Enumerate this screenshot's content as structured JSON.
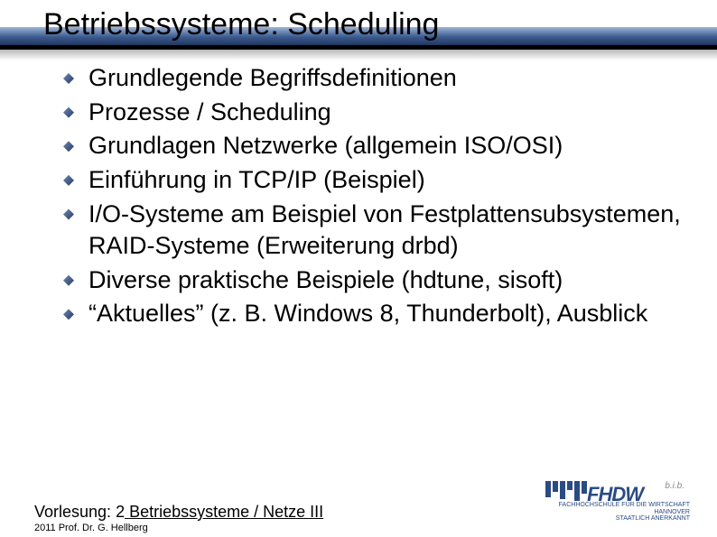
{
  "title": "Betriebssysteme: Scheduling",
  "bullets": [
    "Grundlegende Begriffsdefinitionen",
    "Prozesse / Scheduling",
    "Grundlagen Netzwerke (allgemein ISO/OSI)",
    "Einführung in TCP/IP (Beispiel)",
    "I/O-Systeme am Beispiel von Festplattensubsystemen, RAID-Systeme (Erweiterung drbd)",
    "Diverse praktische Beispiele (hdtune, sisoft)",
    "“Aktuelles” (z. B. Windows 8, Thunderbolt), Ausblick"
  ],
  "footer": {
    "label": "Vorlesung: ",
    "number": "2",
    "course": " Betriebssysteme / Netze III",
    "sub": "2011 Prof. Dr. G. Hellberg"
  },
  "logo": {
    "text": "FHDW",
    "bib": "b.i.b.",
    "sub1": "FACHHOCHSCHULE FÜR DIE WIRTSCHAFT",
    "sub2": "HANNOVER",
    "sub3": "STAATLICH ANERKANNT"
  }
}
